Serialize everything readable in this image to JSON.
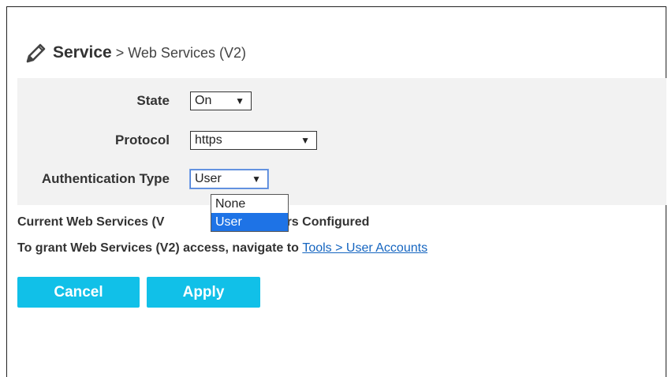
{
  "breadcrumb": {
    "section": "Service",
    "separator": ">",
    "page": "Web Services (V2)"
  },
  "form": {
    "state": {
      "label": "State",
      "value": "On"
    },
    "protocol": {
      "label": "Protocol",
      "value": "https"
    },
    "auth_type": {
      "label": "Authentication Type",
      "value": "User",
      "options": [
        "None",
        "User"
      ],
      "highlighted_index": 1
    }
  },
  "info": {
    "current_users_prefix": "Current Web Services (V",
    "current_users_status": "No Users Configured",
    "grant_text": "To grant Web Services (V2) access, navigate to",
    "grant_link": "Tools > User Accounts"
  },
  "buttons": {
    "cancel": "Cancel",
    "apply": "Apply"
  },
  "icons": {
    "caret": "▼"
  },
  "colors": {
    "button_bg": "#11c0e8",
    "panel_bg": "#f2f2f2",
    "selected_option": "#1e73e6",
    "link": "#1565c0"
  }
}
